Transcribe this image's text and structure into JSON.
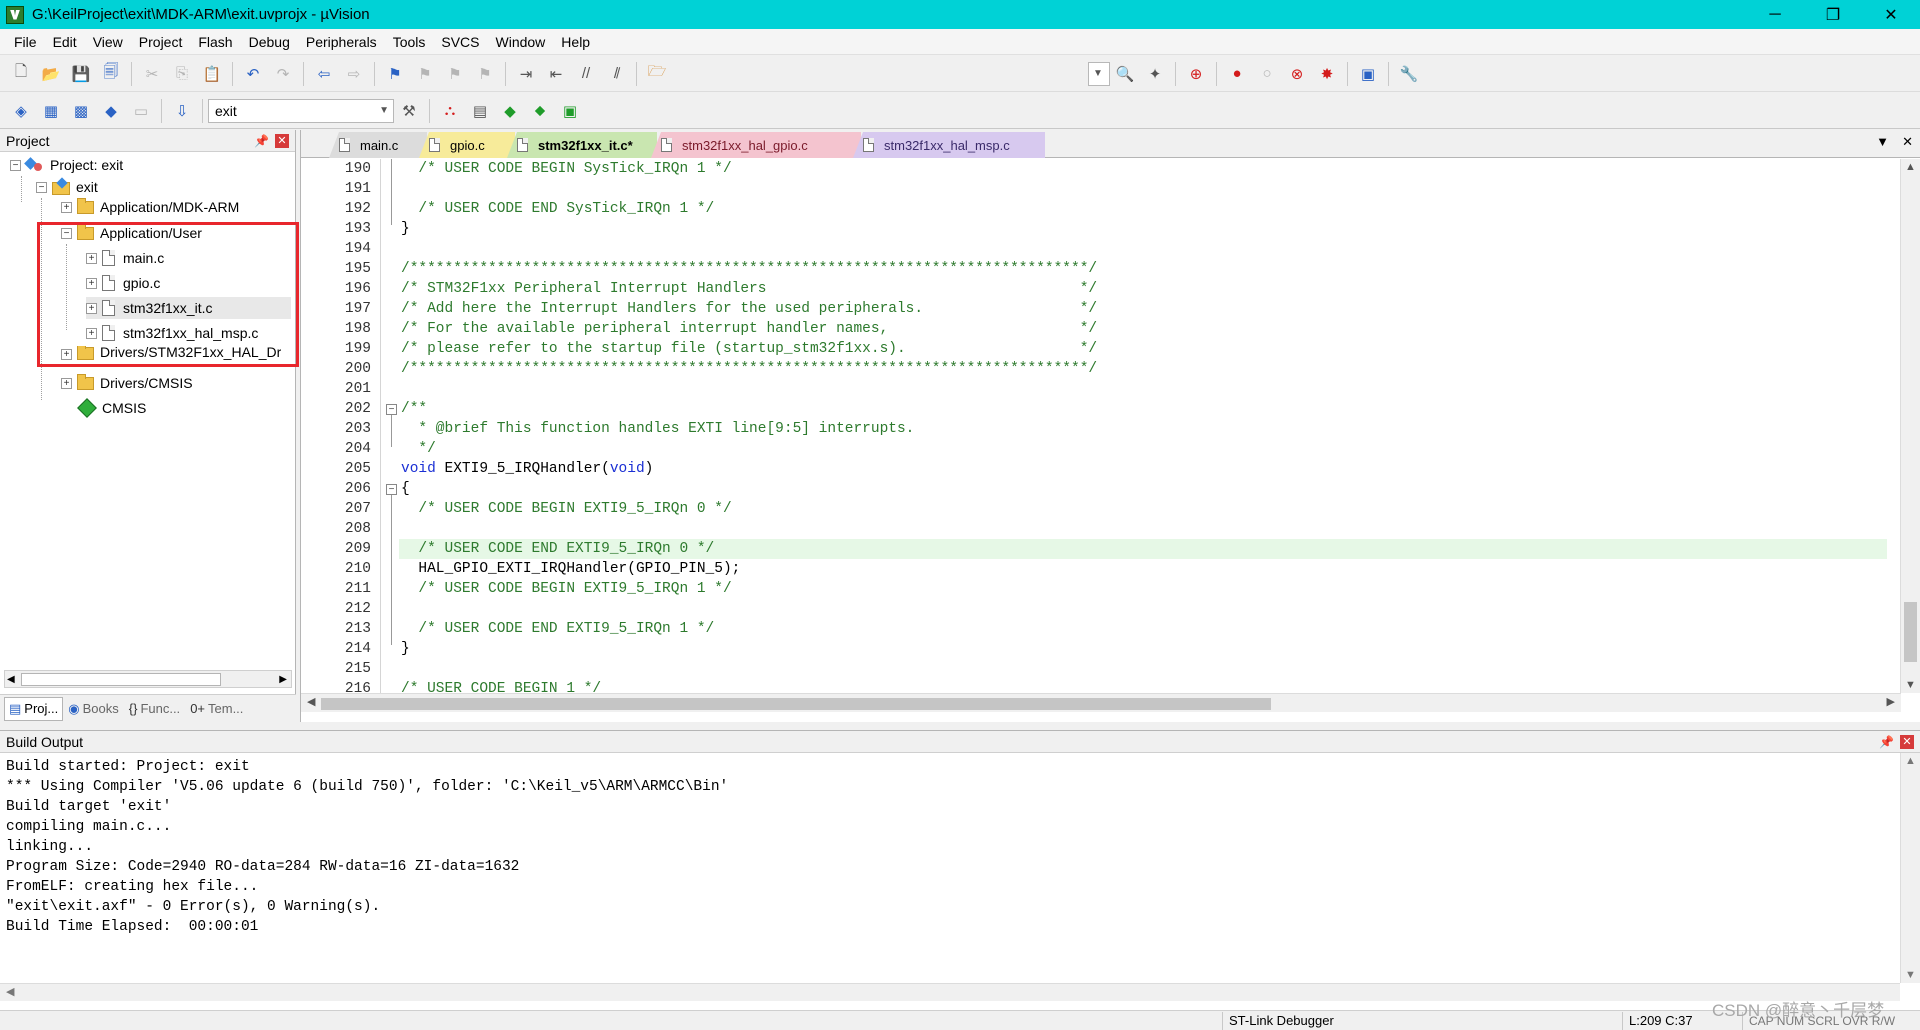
{
  "window": {
    "title": "G:\\KeilProject\\exit\\MDK-ARM\\exit.uvprojx - µVision",
    "controls": [
      "─",
      "❐",
      "✕"
    ]
  },
  "menu": [
    "File",
    "Edit",
    "View",
    "Project",
    "Flash",
    "Debug",
    "Peripherals",
    "Tools",
    "SVCS",
    "Window",
    "Help"
  ],
  "toolbar": {
    "target_combo": "exit"
  },
  "project_panel": {
    "title": "Project",
    "tree": {
      "root": "Project: exit",
      "target": "exit",
      "group_mdk": "Application/MDK-ARM",
      "group_user": "Application/User",
      "files": [
        "main.c",
        "gpio.c",
        "stm32f1xx_it.c",
        "stm32f1xx_hal_msp.c"
      ],
      "group_hal": "Drivers/STM32F1xx_HAL_Dr",
      "group_cmsis": "Drivers/CMSIS",
      "cmsis": "CMSIS"
    },
    "tabs": [
      {
        "icon": "▤",
        "label": "Proj..."
      },
      {
        "icon": "◉",
        "label": "Books"
      },
      {
        "icon": "{}",
        "label": "Func..."
      },
      {
        "icon": "0+",
        "label": "Tem..."
      }
    ]
  },
  "editor": {
    "tabs": [
      "main.c",
      "gpio.c",
      "stm32f1xx_it.c*",
      "stm32f1xx_hal_gpio.c",
      "stm32f1xx_hal_msp.c"
    ],
    "lines": [
      {
        "n": "190",
        "t": "  /* USER CODE BEGIN SysTick_IRQn 1 */",
        "c": "cmt"
      },
      {
        "n": "191",
        "t": "",
        "c": ""
      },
      {
        "n": "192",
        "t": "  /* USER CODE END SysTick_IRQn 1 */",
        "c": "cmt"
      },
      {
        "n": "193",
        "t": "}",
        "c": ""
      },
      {
        "n": "194",
        "t": "",
        "c": ""
      },
      {
        "n": "195",
        "t": "/******************************************************************************/",
        "c": "cmt"
      },
      {
        "n": "196",
        "t": "/* STM32F1xx Peripheral Interrupt Handlers                                    */",
        "c": "cmt"
      },
      {
        "n": "197",
        "t": "/* Add here the Interrupt Handlers for the used peripherals.                  */",
        "c": "cmt"
      },
      {
        "n": "198",
        "t": "/* For the available peripheral interrupt handler names,                      */",
        "c": "cmt"
      },
      {
        "n": "199",
        "t": "/* please refer to the startup file (startup_stm32f1xx.s).                    */",
        "c": "cmt"
      },
      {
        "n": "200",
        "t": "/******************************************************************************/",
        "c": "cmt"
      },
      {
        "n": "201",
        "t": "",
        "c": ""
      },
      {
        "n": "202",
        "t": "/**",
        "c": "cmt"
      },
      {
        "n": "203",
        "t": "  * @brief This function handles EXTI line[9:5] interrupts.",
        "c": "cmt"
      },
      {
        "n": "204",
        "t": "  */",
        "c": "cmt"
      },
      {
        "n": "205",
        "t": "void EXTI9_5_IRQHandler(void)",
        "c": "fn"
      },
      {
        "n": "206",
        "t": "{",
        "c": ""
      },
      {
        "n": "207",
        "t": "  /* USER CODE BEGIN EXTI9_5_IRQn 0 */",
        "c": "cmt"
      },
      {
        "n": "208",
        "t": "",
        "c": ""
      },
      {
        "n": "209",
        "t": "  /* USER CODE END EXTI9_5_IRQn 0 */",
        "c": "cmt"
      },
      {
        "n": "210",
        "t": "  HAL_GPIO_EXTI_IRQHandler(GPIO_PIN_5);",
        "c": ""
      },
      {
        "n": "211",
        "t": "  /* USER CODE BEGIN EXTI9_5_IRQn 1 */",
        "c": "cmt"
      },
      {
        "n": "212",
        "t": "",
        "c": ""
      },
      {
        "n": "213",
        "t": "  /* USER CODE END EXTI9_5_IRQn 1 */",
        "c": "cmt"
      },
      {
        "n": "214",
        "t": "}",
        "c": ""
      },
      {
        "n": "215",
        "t": "",
        "c": ""
      },
      {
        "n": "216",
        "t": "/* USER CODE BEGIN 1 */",
        "c": "cmt"
      }
    ],
    "function_line": {
      "kw1": "void",
      "name": " EXTI9_5_IRQHandler(",
      "kw2": "void",
      "tail": ")"
    }
  },
  "build_output": {
    "title": "Build Output",
    "lines": [
      "Build started: Project: exit",
      "*** Using Compiler 'V5.06 update 6 (build 750)', folder: 'C:\\Keil_v5\\ARM\\ARMCC\\Bin'",
      "Build target 'exit'",
      "compiling main.c...",
      "linking...",
      "Program Size: Code=2940 RO-data=284 RW-data=16 ZI-data=1632",
      "FromELF: creating hex file...",
      "\"exit\\exit.axf\" - 0 Error(s), 0 Warning(s).",
      "Build Time Elapsed:  00:00:01"
    ]
  },
  "status": {
    "debugger": "ST-Link Debugger",
    "position": "L:209 C:37",
    "indicators": "CAP  NUM  SCRL  OVR  R/W",
    "watermark": "CSDN @醉意丶千层梦"
  }
}
